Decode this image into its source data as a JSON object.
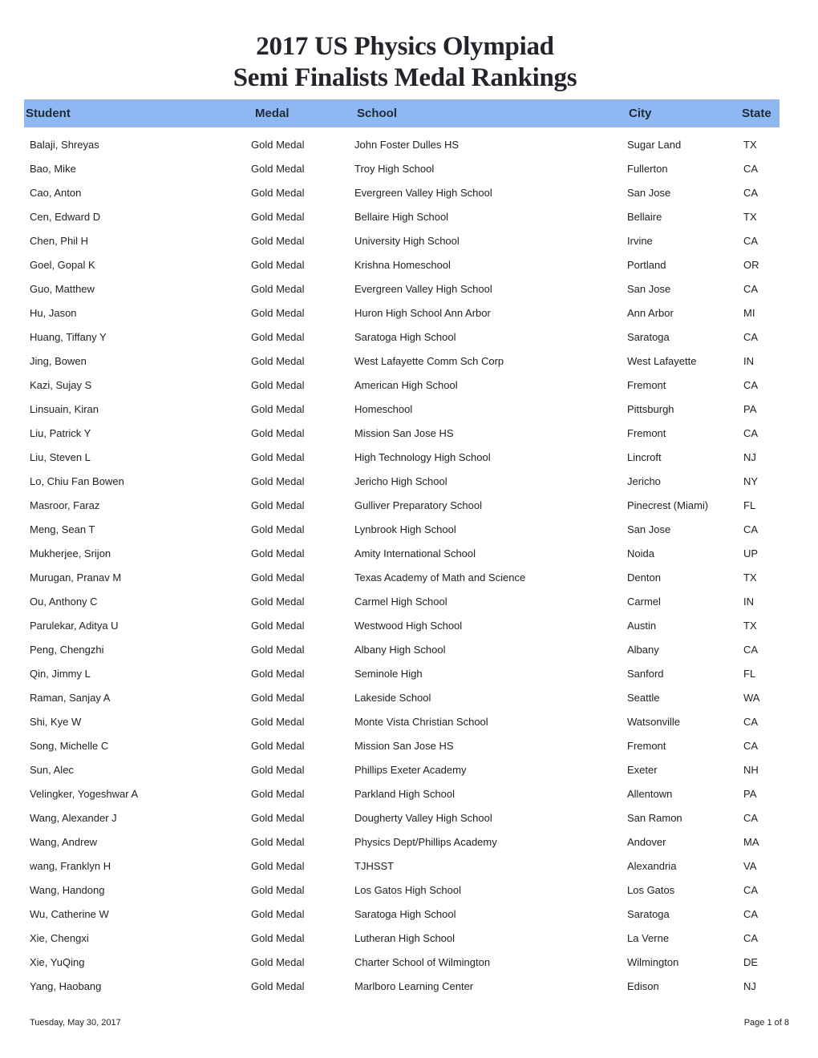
{
  "document": {
    "title_line1": "2017 US Physics Olympiad",
    "title_line2": "Semi Finalists Medal Rankings"
  },
  "colors": {
    "header_bar": "#8db8f2"
  },
  "table": {
    "columns": {
      "student": "Student",
      "medal": "Medal",
      "school": "School",
      "city": "City",
      "state": "State"
    },
    "rows": [
      {
        "student": "Balaji, Shreyas",
        "medal": "Gold Medal",
        "school": "John Foster Dulles HS",
        "city": "Sugar Land",
        "state": "TX"
      },
      {
        "student": "Bao, Mike",
        "medal": "Gold Medal",
        "school": "Troy High School",
        "city": "Fullerton",
        "state": "CA"
      },
      {
        "student": "Cao, Anton",
        "medal": "Gold Medal",
        "school": "Evergreen Valley High School",
        "city": "San Jose",
        "state": "CA"
      },
      {
        "student": "Cen, Edward D",
        "medal": "Gold Medal",
        "school": "Bellaire High School",
        "city": "Bellaire",
        "state": "TX"
      },
      {
        "student": "Chen, Phil H",
        "medal": "Gold Medal",
        "school": "University High School",
        "city": "Irvine",
        "state": "CA"
      },
      {
        "student": "Goel, Gopal K",
        "medal": "Gold Medal",
        "school": "Krishna Homeschool",
        "city": "Portland",
        "state": "OR"
      },
      {
        "student": "Guo, Matthew",
        "medal": "Gold Medal",
        "school": "Evergreen Valley High School",
        "city": "San Jose",
        "state": "CA"
      },
      {
        "student": "Hu, Jason",
        "medal": "Gold Medal",
        "school": "Huron High School Ann Arbor",
        "city": "Ann Arbor",
        "state": "MI"
      },
      {
        "student": "Huang, Tiffany Y",
        "medal": "Gold Medal",
        "school": "Saratoga High School",
        "city": "Saratoga",
        "state": "CA"
      },
      {
        "student": "Jing, Bowen",
        "medal": "Gold Medal",
        "school": "West Lafayette Comm Sch Corp",
        "city": "West Lafayette",
        "state": "IN"
      },
      {
        "student": "Kazi, Sujay S",
        "medal": "Gold Medal",
        "school": "American High School",
        "city": "Fremont",
        "state": "CA"
      },
      {
        "student": "Linsuain, Kiran",
        "medal": "Gold Medal",
        "school": "Homeschool",
        "city": "Pittsburgh",
        "state": "PA"
      },
      {
        "student": "Liu, Patrick Y",
        "medal": "Gold Medal",
        "school": "Mission San Jose HS",
        "city": "Fremont",
        "state": "CA"
      },
      {
        "student": "Liu, Steven L",
        "medal": "Gold Medal",
        "school": "High Technology High School",
        "city": "Lincroft",
        "state": "NJ"
      },
      {
        "student": "Lo, Chiu Fan Bowen",
        "medal": "Gold Medal",
        "school": "Jericho High School",
        "city": "Jericho",
        "state": "NY"
      },
      {
        "student": "Masroor, Faraz",
        "medal": "Gold Medal",
        "school": "Gulliver Preparatory School",
        "city": "Pinecrest (Miami)",
        "state": "FL"
      },
      {
        "student": "Meng, Sean T",
        "medal": "Gold Medal",
        "school": "Lynbrook High School",
        "city": "San Jose",
        "state": "CA"
      },
      {
        "student": "Mukherjee, Srijon",
        "medal": "Gold Medal",
        "school": "Amity International School",
        "city": "Noida",
        "state": "UP"
      },
      {
        "student": "Murugan, Pranav M",
        "medal": "Gold Medal",
        "school": "Texas Academy of Math and Science",
        "city": "Denton",
        "state": "TX"
      },
      {
        "student": "Ou, Anthony C",
        "medal": "Gold Medal",
        "school": "Carmel High School",
        "city": "Carmel",
        "state": "IN"
      },
      {
        "student": "Parulekar, Aditya U",
        "medal": "Gold Medal",
        "school": "Westwood High School",
        "city": "Austin",
        "state": "TX"
      },
      {
        "student": "Peng, Chengzhi",
        "medal": "Gold Medal",
        "school": "Albany High School",
        "city": "Albany",
        "state": "CA"
      },
      {
        "student": "Qin, Jimmy L",
        "medal": "Gold Medal",
        "school": "Seminole High",
        "city": "Sanford",
        "state": "FL"
      },
      {
        "student": "Raman, Sanjay A",
        "medal": "Gold Medal",
        "school": "Lakeside School",
        "city": "Seattle",
        "state": "WA"
      },
      {
        "student": "Shi, Kye W",
        "medal": "Gold Medal",
        "school": "Monte Vista Christian School",
        "city": "Watsonville",
        "state": "CA"
      },
      {
        "student": "Song, Michelle C",
        "medal": "Gold Medal",
        "school": "Mission San Jose HS",
        "city": "Fremont",
        "state": "CA"
      },
      {
        "student": "Sun, Alec",
        "medal": "Gold Medal",
        "school": "Phillips Exeter Academy",
        "city": "Exeter",
        "state": "NH"
      },
      {
        "student": "Velingker, Yogeshwar A",
        "medal": "Gold Medal",
        "school": "Parkland High School",
        "city": "Allentown",
        "state": "PA"
      },
      {
        "student": "Wang, Alexander J",
        "medal": "Gold Medal",
        "school": "Dougherty Valley High School",
        "city": "San Ramon",
        "state": "CA"
      },
      {
        "student": "Wang, Andrew",
        "medal": "Gold Medal",
        "school": "Physics Dept/Phillips Academy",
        "city": "Andover",
        "state": "MA"
      },
      {
        "student": "wang, Franklyn H",
        "medal": "Gold Medal",
        "school": "TJHSST",
        "city": "Alexandria",
        "state": "VA"
      },
      {
        "student": "Wang, Handong",
        "medal": "Gold Medal",
        "school": "Los Gatos High School",
        "city": "Los Gatos",
        "state": "CA"
      },
      {
        "student": "Wu, Catherine W",
        "medal": "Gold Medal",
        "school": "Saratoga High School",
        "city": "Saratoga",
        "state": "CA"
      },
      {
        "student": "Xie, Chengxi",
        "medal": "Gold Medal",
        "school": "Lutheran High School",
        "city": "La Verne",
        "state": "CA"
      },
      {
        "student": "Xie, YuQing",
        "medal": "Gold Medal",
        "school": "Charter School of Wilmington",
        "city": "Wilmington",
        "state": "DE"
      },
      {
        "student": "Yang, Haobang",
        "medal": "Gold Medal",
        "school": "Marlboro Learning Center",
        "city": "Edison",
        "state": "NJ"
      }
    ]
  },
  "footer": {
    "date": "Tuesday, May 30, 2017",
    "page": "Page 1 of 8"
  }
}
